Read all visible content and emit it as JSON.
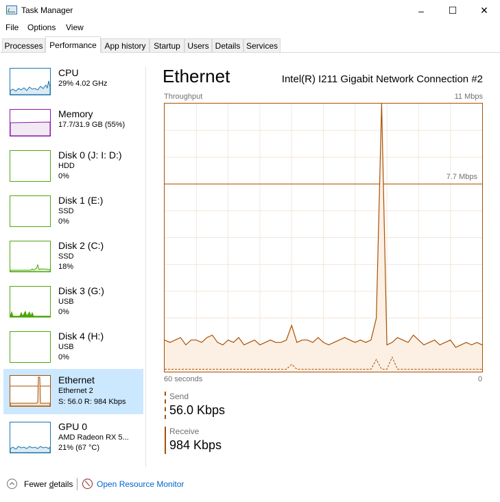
{
  "window": {
    "title": "Task Manager"
  },
  "menu": {
    "file": "File",
    "options": "Options",
    "view": "View"
  },
  "tabs": [
    "Processes",
    "Performance",
    "App history",
    "Startup",
    "Users",
    "Details",
    "Services"
  ],
  "active_tab": "Performance",
  "sidebar": {
    "items": [
      {
        "name": "CPU",
        "sub1": "29%  4.02 GHz",
        "sub2": "",
        "color": "#1a74a8"
      },
      {
        "name": "Memory",
        "sub1": "17.7/31.9 GB (55%)",
        "sub2": "",
        "color": "#8b12ae"
      },
      {
        "name": "Disk 0 (J: I: D:)",
        "sub1": "HDD",
        "sub2": "0%",
        "color": "#4da60c"
      },
      {
        "name": "Disk 1 (E:)",
        "sub1": "SSD",
        "sub2": "0%",
        "color": "#4da60c"
      },
      {
        "name": "Disk 2 (C:)",
        "sub1": "SSD",
        "sub2": "18%",
        "color": "#4da60c"
      },
      {
        "name": "Disk 3 (G:)",
        "sub1": "USB",
        "sub2": "0%",
        "color": "#4da60c"
      },
      {
        "name": "Disk 4 (H:)",
        "sub1": "USB",
        "sub2": "0%",
        "color": "#4da60c"
      },
      {
        "name": "Ethernet",
        "sub1": "Ethernet 2",
        "sub2": "S: 56.0  R: 984 Kbps",
        "color": "#a74f01"
      },
      {
        "name": "GPU 0",
        "sub1": "AMD Radeon RX 5...",
        "sub2": "21% (67 °C)",
        "color": "#1a74a8"
      }
    ],
    "selected": "Ethernet"
  },
  "main": {
    "title": "Ethernet",
    "adapter": "Intel(R) I211 Gigabit Network Connection #2",
    "throughput_label": "Throughput",
    "max_label": "11 Mbps",
    "mid_label": "7.7 Mbps",
    "x_left": "60 seconds",
    "x_right": "0",
    "send_label": "Send",
    "send_value": "56.0 Kbps",
    "receive_label": "Receive",
    "receive_value": "984 Kbps",
    "accent_color": "#a74f01"
  },
  "chart_data": {
    "type": "area",
    "x_unit": "seconds ago",
    "xlim": [
      60,
      0
    ],
    "ylim": [
      0,
      11
    ],
    "y_unit": "Mbps",
    "receive_mbps": [
      1.3,
      1.2,
      1.3,
      1.4,
      1.1,
      1.3,
      1.3,
      1.2,
      1.4,
      1.5,
      1.2,
      1.1,
      1.3,
      1.2,
      1.4,
      1.1,
      1.2,
      1.3,
      1.1,
      1.2,
      1.3,
      1.2,
      1.2,
      1.3,
      1.9,
      1.2,
      1.3,
      1.3,
      1.2,
      1.4,
      1.2,
      1.1,
      1.2,
      1.3,
      1.4,
      1.3,
      1.2,
      1.3,
      1.2,
      1.3,
      2.2,
      11.0,
      1.1,
      1.2,
      1.4,
      1.3,
      1.2,
      1.5,
      1.3,
      1.1,
      1.2,
      1.3,
      1.1,
      1.2,
      1.3,
      1.0,
      1.1,
      1.2,
      1.1,
      1.2,
      1.1
    ],
    "send_mbps": [
      0.1,
      0.1,
      0.1,
      0.1,
      0.1,
      0.1,
      0.1,
      0.1,
      0.1,
      0.1,
      0.1,
      0.1,
      0.1,
      0.1,
      0.1,
      0.1,
      0.1,
      0.1,
      0.1,
      0.1,
      0.1,
      0.1,
      0.1,
      0.1,
      0.3,
      0.1,
      0.1,
      0.1,
      0.1,
      0.1,
      0.1,
      0.1,
      0.1,
      0.1,
      0.1,
      0.1,
      0.1,
      0.1,
      0.1,
      0.1,
      0.5,
      0.1,
      0.1,
      0.6,
      0.1,
      0.1,
      0.1,
      0.1,
      0.1,
      0.1,
      0.1,
      0.1,
      0.1,
      0.1,
      0.1,
      0.1,
      0.1,
      0.1,
      0.1,
      0.1,
      0.1
    ]
  }
}
